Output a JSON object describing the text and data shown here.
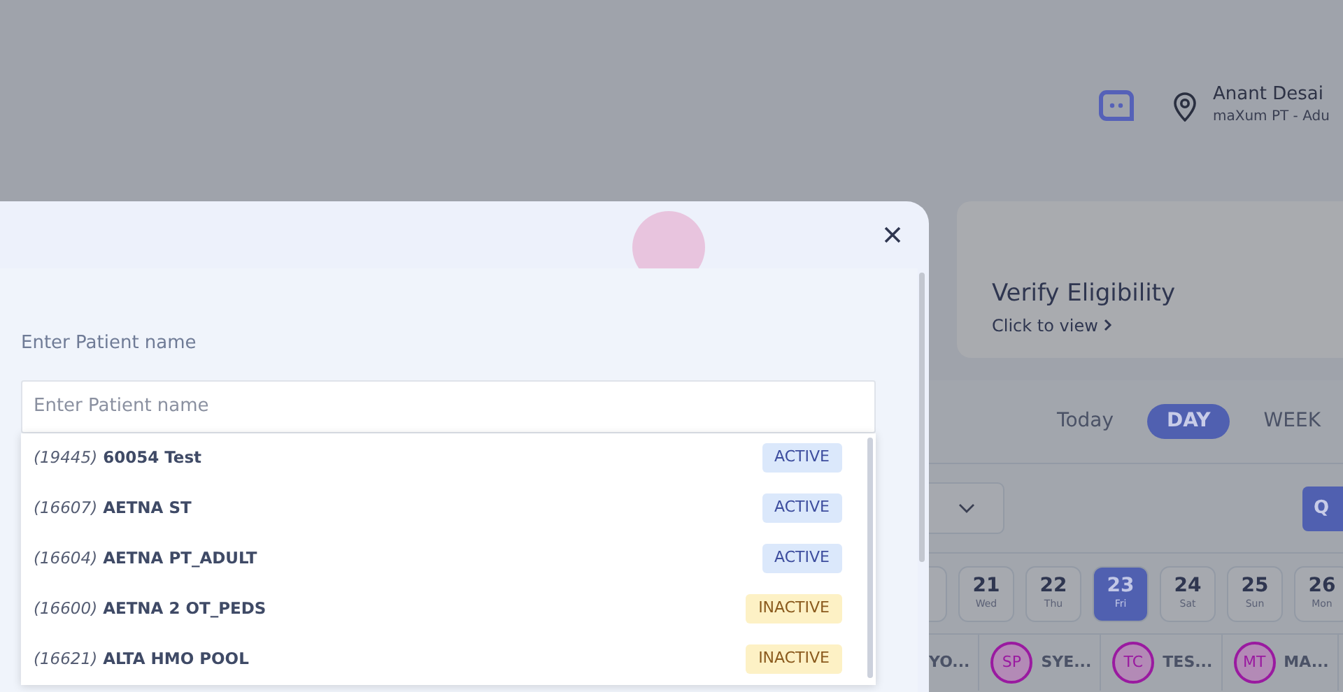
{
  "header": {
    "user_name": "Anant Desai",
    "user_subtitle": "maXum PT - Adu"
  },
  "eligibility_card": {
    "title": "Verify Eligibility",
    "link": "Click to view"
  },
  "view_tabs": [
    {
      "label": "Today",
      "selected": false
    },
    {
      "label": "DAY",
      "selected": true
    },
    {
      "label": "WEEK",
      "selected": false
    }
  ],
  "action_button": {
    "label": "Q"
  },
  "dates": [
    {
      "day": "21",
      "weekday": "Wed",
      "selected": false
    },
    {
      "day": "22",
      "weekday": "Thu",
      "selected": false
    },
    {
      "day": "23",
      "weekday": "Fri",
      "selected": true
    },
    {
      "day": "24",
      "weekday": "Sat",
      "selected": false
    },
    {
      "day": "25",
      "weekday": "Sun",
      "selected": false
    },
    {
      "day": "26",
      "weekday": "Mon",
      "selected": false
    }
  ],
  "providers": [
    {
      "name": "YO..."
    },
    {
      "initials": "SP",
      "name": "SYE..."
    },
    {
      "initials": "TC",
      "name": "TES..."
    },
    {
      "initials": "MT",
      "name": "MA..."
    }
  ],
  "patient_modal": {
    "field_label": "Enter Patient name",
    "placeholder": "Enter Patient name",
    "results": [
      {
        "id": "(19445)",
        "name": "60054 Test",
        "status": "ACTIVE",
        "active": true
      },
      {
        "id": "(16607)",
        "name": "AETNA ST",
        "status": "ACTIVE",
        "active": true
      },
      {
        "id": "(16604)",
        "name": "AETNA PT_ADULT",
        "status": "ACTIVE",
        "active": true
      },
      {
        "id": "(16600)",
        "name": "AETNA 2 OT_PEDS",
        "status": "INACTIVE",
        "active": false
      },
      {
        "id": "(16621)",
        "name": "ALTA HMO POOL",
        "status": "INACTIVE",
        "active": false
      }
    ]
  }
}
